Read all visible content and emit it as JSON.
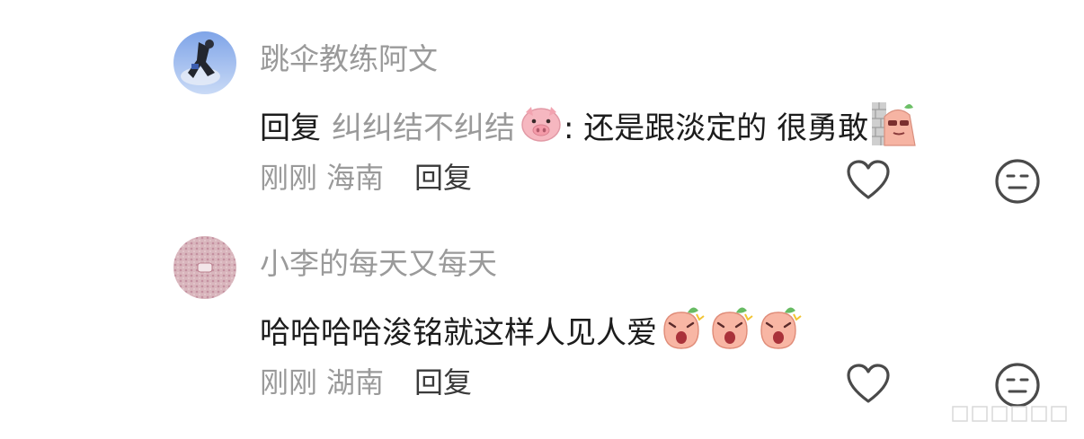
{
  "comments": [
    {
      "username": "跳伞教练阿文",
      "reply_prefix": "回复",
      "mention": "纠纠结不纠结",
      "text": ": 还是跟淡定的 很勇敢",
      "time": "刚刚",
      "location": "海南",
      "reply_label": "回复",
      "icons": [
        "parachute-avatar",
        "pig-emoji",
        "peeking-emoji",
        "heart-icon",
        "neutral-face-icon"
      ]
    },
    {
      "username": "小李的每天又每天",
      "text": "哈哈哈哈浚铭就这样人见人爱",
      "time": "刚刚",
      "location": "湖南",
      "reply_label": "回复",
      "icons": [
        "pink-pattern-avatar",
        "excited-peach-emoji",
        "heart-icon",
        "neutral-face-icon"
      ]
    }
  ],
  "colors": {
    "text": "#1c1c1c",
    "muted": "#9a9a9a",
    "icon": "#4a4a4a"
  }
}
